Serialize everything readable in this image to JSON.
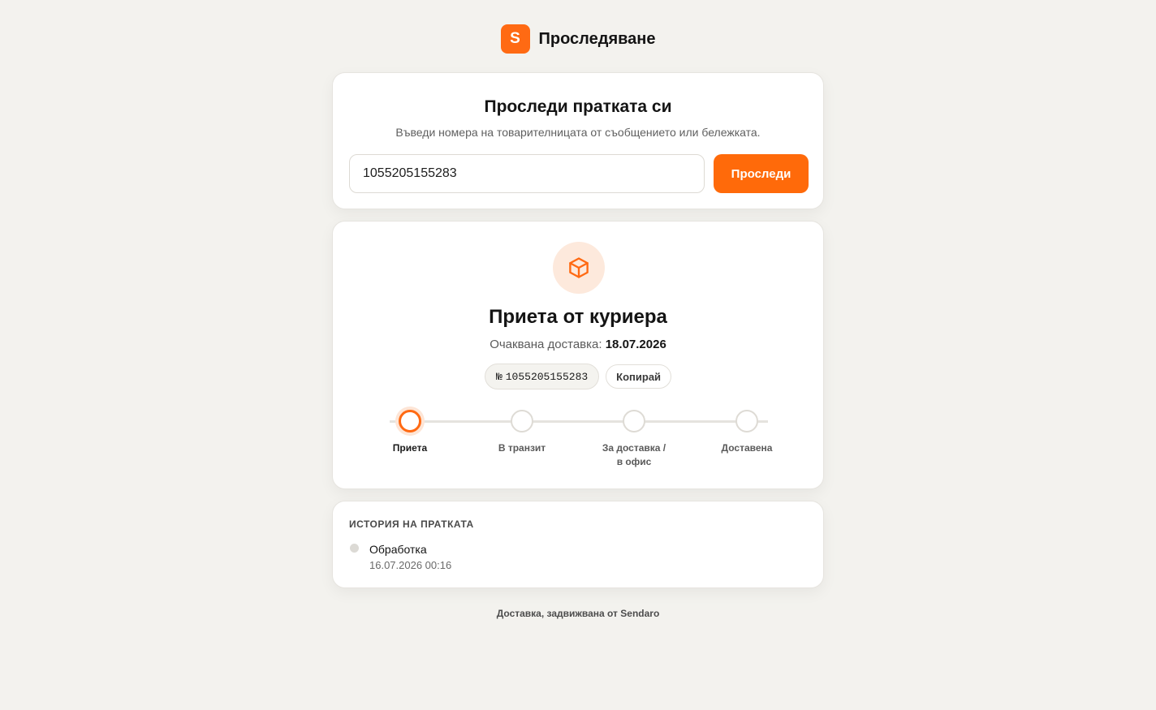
{
  "brand": {
    "logo_letter": "S",
    "title": "Проследяване",
    "accent_color": "#ff6a13"
  },
  "search": {
    "title": "Проследи пратката си",
    "subtitle": "Въведи номера на товарителницата от съобщението или бележката.",
    "input_value": "1055205155283",
    "button_label": "Проследи"
  },
  "status": {
    "icon": "package-icon",
    "title": "Приета от куриера",
    "eta_label": "Очаквана доставка:",
    "eta_date": "18.07.2026",
    "tracking_prefix": "№",
    "tracking_number": "1055205155283",
    "copy_label": "Копирай",
    "steps": [
      {
        "label": "Приета",
        "active": true
      },
      {
        "label": "В транзит",
        "active": false
      },
      {
        "label_line1": "За доставка /",
        "label_line2": "в офис",
        "active": false
      },
      {
        "label": "Доставена",
        "active": false
      }
    ]
  },
  "history": {
    "heading": "ИСТОРИЯ НА ПРАТКАТА",
    "events": [
      {
        "title": "Обработка",
        "time": "16.07.2026 00:16"
      }
    ]
  },
  "footer": {
    "text": "Доставка, задвижвана от Sendaro"
  }
}
